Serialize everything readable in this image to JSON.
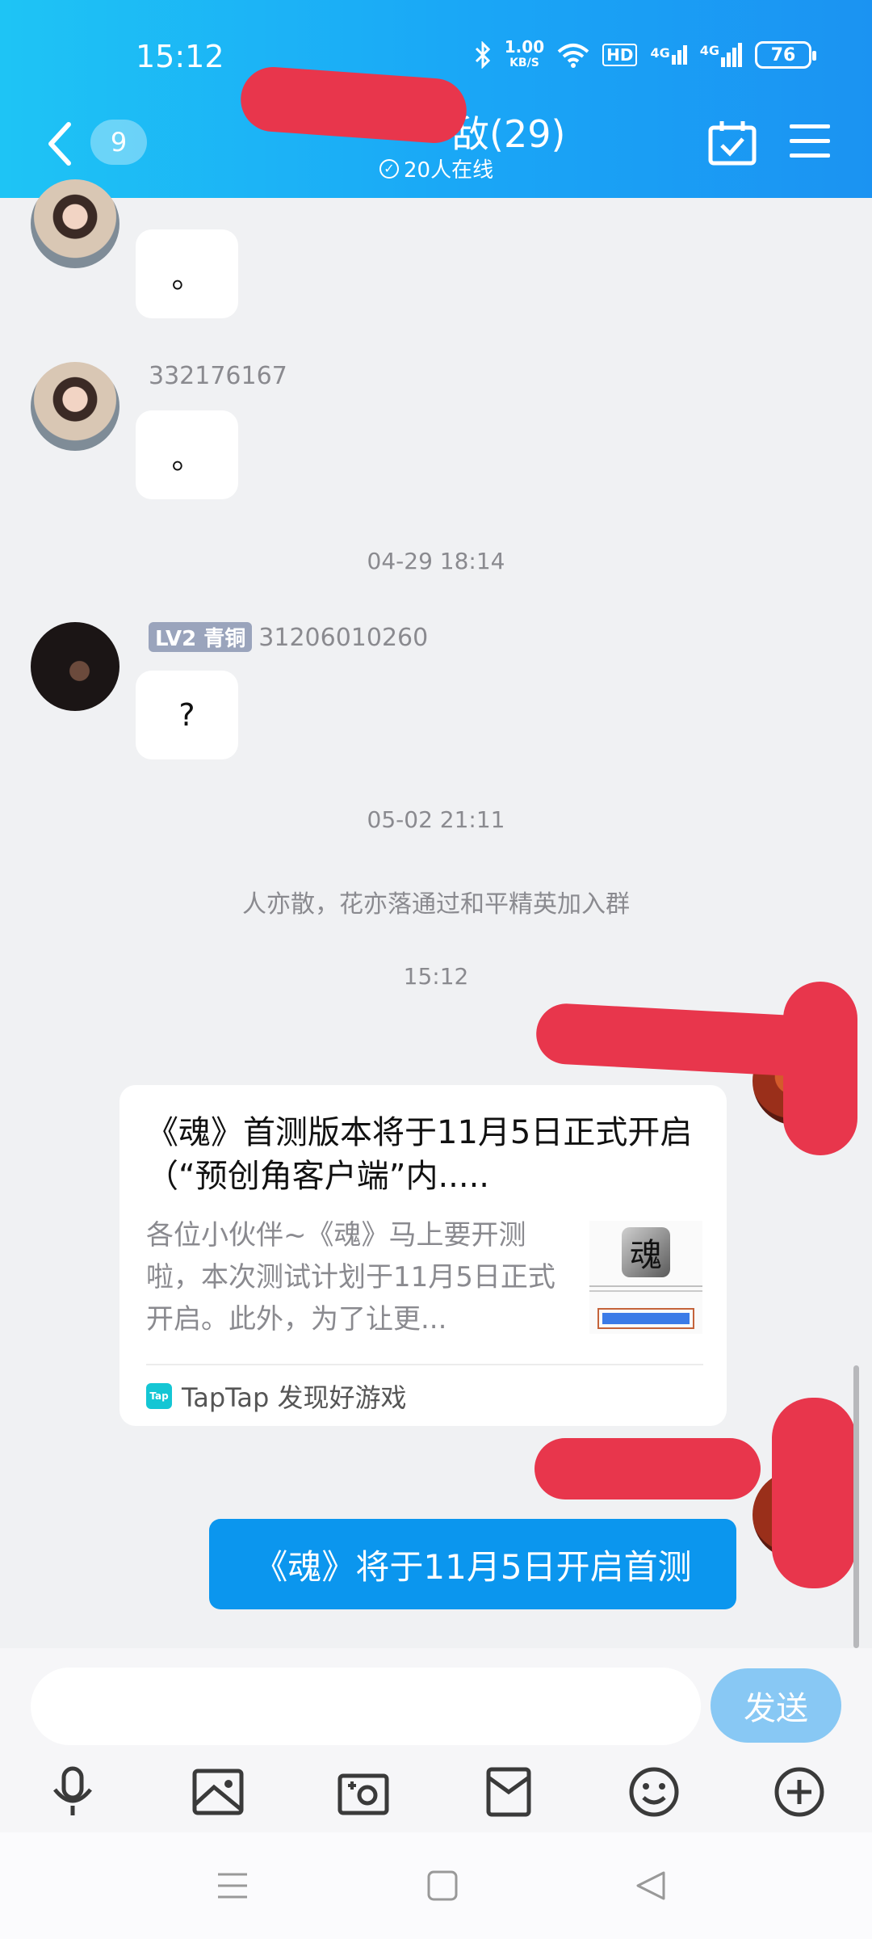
{
  "status_bar": {
    "time": "15:12",
    "net_speed_value": "1.00",
    "net_speed_unit": "KB/S",
    "hd_label": "HD",
    "signal1": "4G",
    "signal2": "4G",
    "battery": "76"
  },
  "header": {
    "unread_count": "9",
    "group_title_visible": "敌(29)",
    "online_text": "20人在线"
  },
  "messages": [
    {
      "sender": "332176167",
      "text": "。"
    },
    {
      "sender": "332176167",
      "text": "。"
    },
    {
      "timestamp": "04-29 18:14"
    },
    {
      "level_badge": "LV2 青铜",
      "sender": "31206010260",
      "text": "?"
    },
    {
      "timestamp": "05-02 21:11"
    },
    {
      "system": "人亦散，花亦落通过和平精英加入群"
    },
    {
      "timestamp": "15:12"
    }
  ],
  "share_card": {
    "title": "《魂》首测版本将于11月5日正式开启（“预创角客户端”内.....",
    "description": "各位小伙伴~《魂》马上要开测啦，本次测试计划于11月5日正式开启。此外，为了让更...",
    "thumb_logo_glyph": "魂",
    "tap_logo_text": "Tap",
    "source": "TapTap 发现好游戏"
  },
  "my_message": "《魂》将于11月5日开启首测",
  "input": {
    "placeholder": "",
    "send_label": "发送"
  },
  "toolbar_icons": [
    "microphone-icon",
    "image-icon",
    "camera-icon",
    "red-packet-icon",
    "emoji-icon",
    "plus-icon"
  ],
  "nav_icons": [
    "menu-icon",
    "home-square-icon",
    "back-triangle-icon"
  ],
  "colors": {
    "header_gradient_start": "#1ec4f5",
    "header_gradient_end": "#1b93f2",
    "my_bubble": "#0b96ee",
    "send_button": "#88c8f4",
    "redaction": "#e8364c"
  }
}
